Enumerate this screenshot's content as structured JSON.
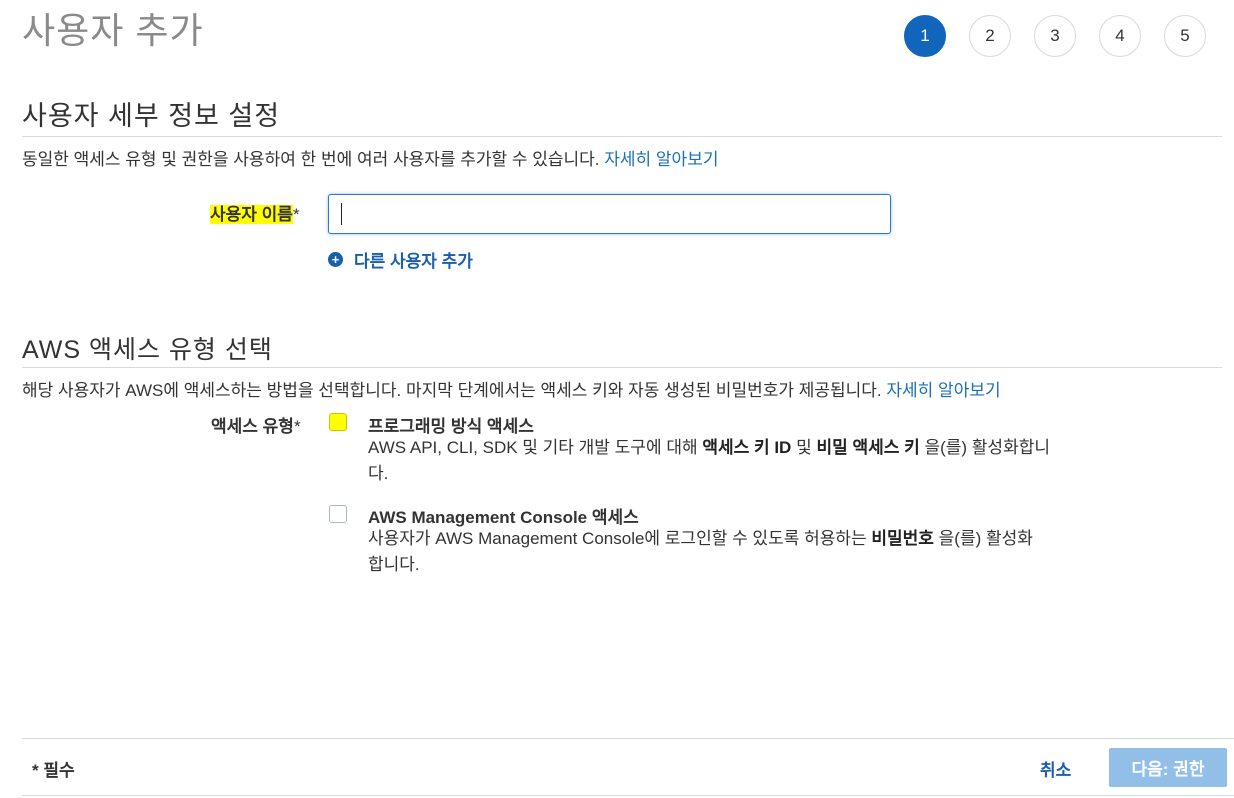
{
  "page": {
    "title": "사용자 추가"
  },
  "steps": [
    "1",
    "2",
    "3",
    "4",
    "5"
  ],
  "user_details": {
    "heading": "사용자 세부 정보 설정",
    "description": "동일한 액세스 유형 및 권한을 사용하여 한 번에 여러 사용자를 추가할 수 있습니다.",
    "learn_more": "자세히 알아보기",
    "username_label": "사용자 이름",
    "required_mark": "*",
    "username_value": "",
    "add_user_label": "다른 사용자 추가",
    "add_icon": "plus-circle-icon"
  },
  "access_type": {
    "heading": "AWS 액세스 유형 선택",
    "description": "해당 사용자가 AWS에 액세스하는 방법을 선택합니다. 마지막 단계에서는 액세스 키와 자동 생성된 비밀번호가 제공됩니다.",
    "learn_more": "자세히 알아보기",
    "label": "액세스 유형",
    "required_mark": "*",
    "options": [
      {
        "title": "프로그래밍 방식 액세스",
        "desc_pre": "AWS API, CLI, SDK 및 기타 개발 도구에 대해 ",
        "desc_bold1": "액세스 키 ID",
        "desc_mid": " 및 ",
        "desc_bold2": "비밀 액세스 키",
        "desc_post": " 을(를) 활성화합니다.",
        "checked": false
      },
      {
        "title": "AWS Management Console 액세스",
        "desc_pre": "사용자가 AWS Management Console에 로그인할 수 있도록 허용하는 ",
        "desc_bold1": "비밀번호",
        "desc_post": " 을(를) 활성화합니다.",
        "checked": false
      }
    ]
  },
  "footer": {
    "required_note": "* 필수",
    "cancel_label": "취소",
    "next_label": "다음: 권한"
  },
  "colors": {
    "accent": "#1166bb",
    "link": "#1a6fb7",
    "highlight": "#ffff00",
    "next_button_disabled": "#92bfe8"
  }
}
